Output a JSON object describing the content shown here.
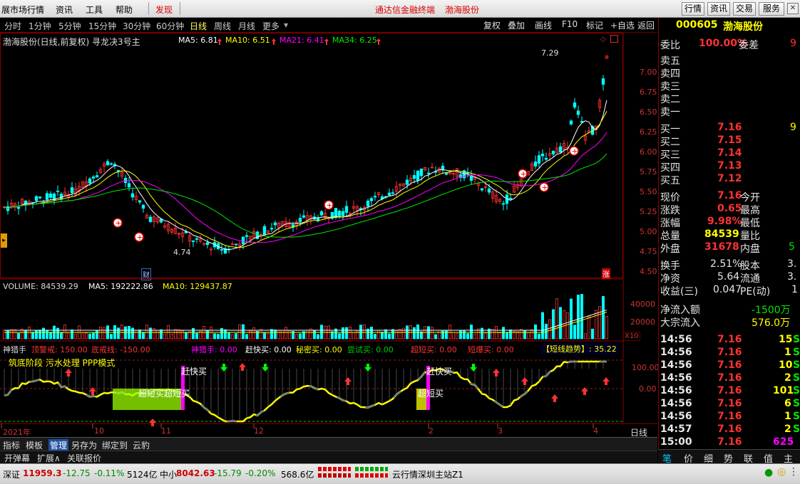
{
  "menu": {
    "items": [
      "展市场行情",
      "资讯",
      "工具",
      "帮助"
    ],
    "discover": "发现",
    "center_title": "通达信金融终端",
    "stock_title": "渤海股份",
    "right_buttons": [
      "行情",
      "资讯",
      "交易",
      "服务"
    ]
  },
  "periods": {
    "items": [
      "分时",
      "1分钟",
      "5分钟",
      "15分钟",
      "30分钟",
      "60分钟",
      "日线",
      "周线",
      "月线",
      "更多"
    ],
    "active": "日线",
    "right_buttons": [
      "复权",
      "叠加",
      "画线",
      "F10",
      "标记",
      "+自选",
      "返回"
    ]
  },
  "main_panel": {
    "title": "渤海股份(日线,前复权) 寻龙决3号主",
    "ma5": "MA5: 6.81",
    "ma10": "MA10: 6.51",
    "ma21": "MA21: 6.41",
    "ma34": "MA34: 6.25",
    "high_label": "7.29",
    "low_label": "4.74",
    "cai_tag": "财",
    "zhang_tag": "涨",
    "y_ticks": [
      "7.00",
      "6.75",
      "6.50",
      "6.25",
      "6.00",
      "5.75",
      "5.50",
      "5.25",
      "5.00",
      "4.75",
      "4.50"
    ]
  },
  "volume_panel": {
    "volume": "VOLUME: 84539.29",
    "ma5": "MA5: 192222.86",
    "ma10": "MA10: 129437.87",
    "y_ticks": [
      "40000",
      "20000"
    ],
    "unit": "X10"
  },
  "indicator_panel": {
    "name": "神猎手",
    "warn": "顶警戒: 150.00",
    "floor": "底戒线: -150.00",
    "hunter": "神猎手: 0.00",
    "quick_buy": "赶快买: 0.00",
    "secret_buy": "秘密买: 0.00",
    "try_buy": "尝试买: 0.00",
    "super_short": "超短买: 0.00",
    "short_burst": "短爆买: 0.00",
    "trend": "【短线趋势】: 35.22",
    "mode_text": "筑底阶段  污水处理 PPP模式",
    "overlay_quick1": "赶快买",
    "overlay_quick2": "赶快买",
    "overlay_super1": "超短买超短买",
    "overlay_super2": "超短买",
    "y_ticks": [
      "100.00",
      "0.00"
    ]
  },
  "x_axis": [
    "2021年",
    "10",
    "11",
    "12",
    "2",
    "3",
    "4"
  ],
  "period_label": "日线",
  "right_panel": {
    "code": "000605",
    "name": "渤海股份",
    "weibi_label": "委比",
    "weibi": "100.00%",
    "weicha_label": "委差",
    "weicha": "9",
    "sell": [
      "卖五",
      "卖四",
      "卖三",
      "卖二",
      "卖一"
    ],
    "buy": [
      {
        "label": "买一",
        "price": "7.16",
        "vol": "9"
      },
      {
        "label": "买二",
        "price": "7.15",
        "vol": ""
      },
      {
        "label": "买三",
        "price": "7.14",
        "vol": ""
      },
      {
        "label": "买四",
        "price": "7.13",
        "vol": ""
      },
      {
        "label": "买五",
        "price": "7.12",
        "vol": ""
      }
    ],
    "quotes": [
      {
        "l": "现价",
        "v": "7.16",
        "l2": "今开",
        "v2": ""
      },
      {
        "l": "涨跌",
        "v": "0.65",
        "l2": "最高",
        "v2": ""
      },
      {
        "l": "涨幅",
        "v": "9.98%",
        "l2": "最低",
        "v2": ""
      },
      {
        "l": "总量",
        "v": "84539",
        "l2": "量比",
        "v2": ""
      },
      {
        "l": "外盘",
        "v": "31678",
        "l2": "内盘",
        "v2": "5"
      }
    ],
    "quotes2": [
      {
        "l": "换手",
        "v": "2.51%",
        "l2": "股本",
        "v2": "3."
      },
      {
        "l": "净资",
        "v": "5.64",
        "l2": "流通",
        "v2": "3."
      },
      {
        "l": "收益(三)",
        "v": "0.047",
        "l2": "PE(动)",
        "v2": "1"
      }
    ],
    "net_inflow_label": "净流入额",
    "net_inflow": "-1500万",
    "bulk_inflow_label": "大宗流入",
    "bulk_inflow": "576.0万",
    "ticks": [
      {
        "t": "14:56",
        "p": "7.16",
        "v": "15",
        "s": "S"
      },
      {
        "t": "14:56",
        "p": "7.16",
        "v": "1",
        "s": "S"
      },
      {
        "t": "14:56",
        "p": "7.16",
        "v": "10",
        "s": "S"
      },
      {
        "t": "14:56",
        "p": "7.16",
        "v": "2",
        "s": "S"
      },
      {
        "t": "14:56",
        "p": "7.16",
        "v": "101",
        "s": "S"
      },
      {
        "t": "14:56",
        "p": "7.16",
        "v": "6",
        "s": "S"
      },
      {
        "t": "14:56",
        "p": "7.16",
        "v": "1",
        "s": "S"
      },
      {
        "t": "14:57",
        "p": "7.16",
        "v": "2",
        "s": "S"
      },
      {
        "t": "15:00",
        "p": "7.16",
        "v": "625",
        "s": ""
      }
    ],
    "tabs": [
      "笔",
      "价",
      "细",
      "势",
      "联",
      "值",
      "主"
    ]
  },
  "bottom_tabs": [
    "指标",
    "模板",
    "管理",
    "另存为",
    "绑定到",
    "云豹"
  ],
  "bottom_tabs2": [
    "开弹幕",
    "扩展∧",
    "关联报价"
  ],
  "status": {
    "sz_label": "深证",
    "sz_value": "11959.3",
    "sz_change": "-12.75",
    "sz_pct": "-0.11%",
    "sz_amount": "5124亿",
    "zx_label": "中小",
    "zx_value": "8042.63",
    "zx_change": "-15.79",
    "zx_pct": "-0.20%",
    "zx_amount": "568.6亿",
    "server": "云行情深圳主站Z1"
  },
  "colors": {
    "up": "#ff3232",
    "down": "#00ffff",
    "ma5": "#ffffff",
    "ma10": "#ffff00",
    "ma21": "#ff00ff",
    "ma34": "#00e600"
  }
}
